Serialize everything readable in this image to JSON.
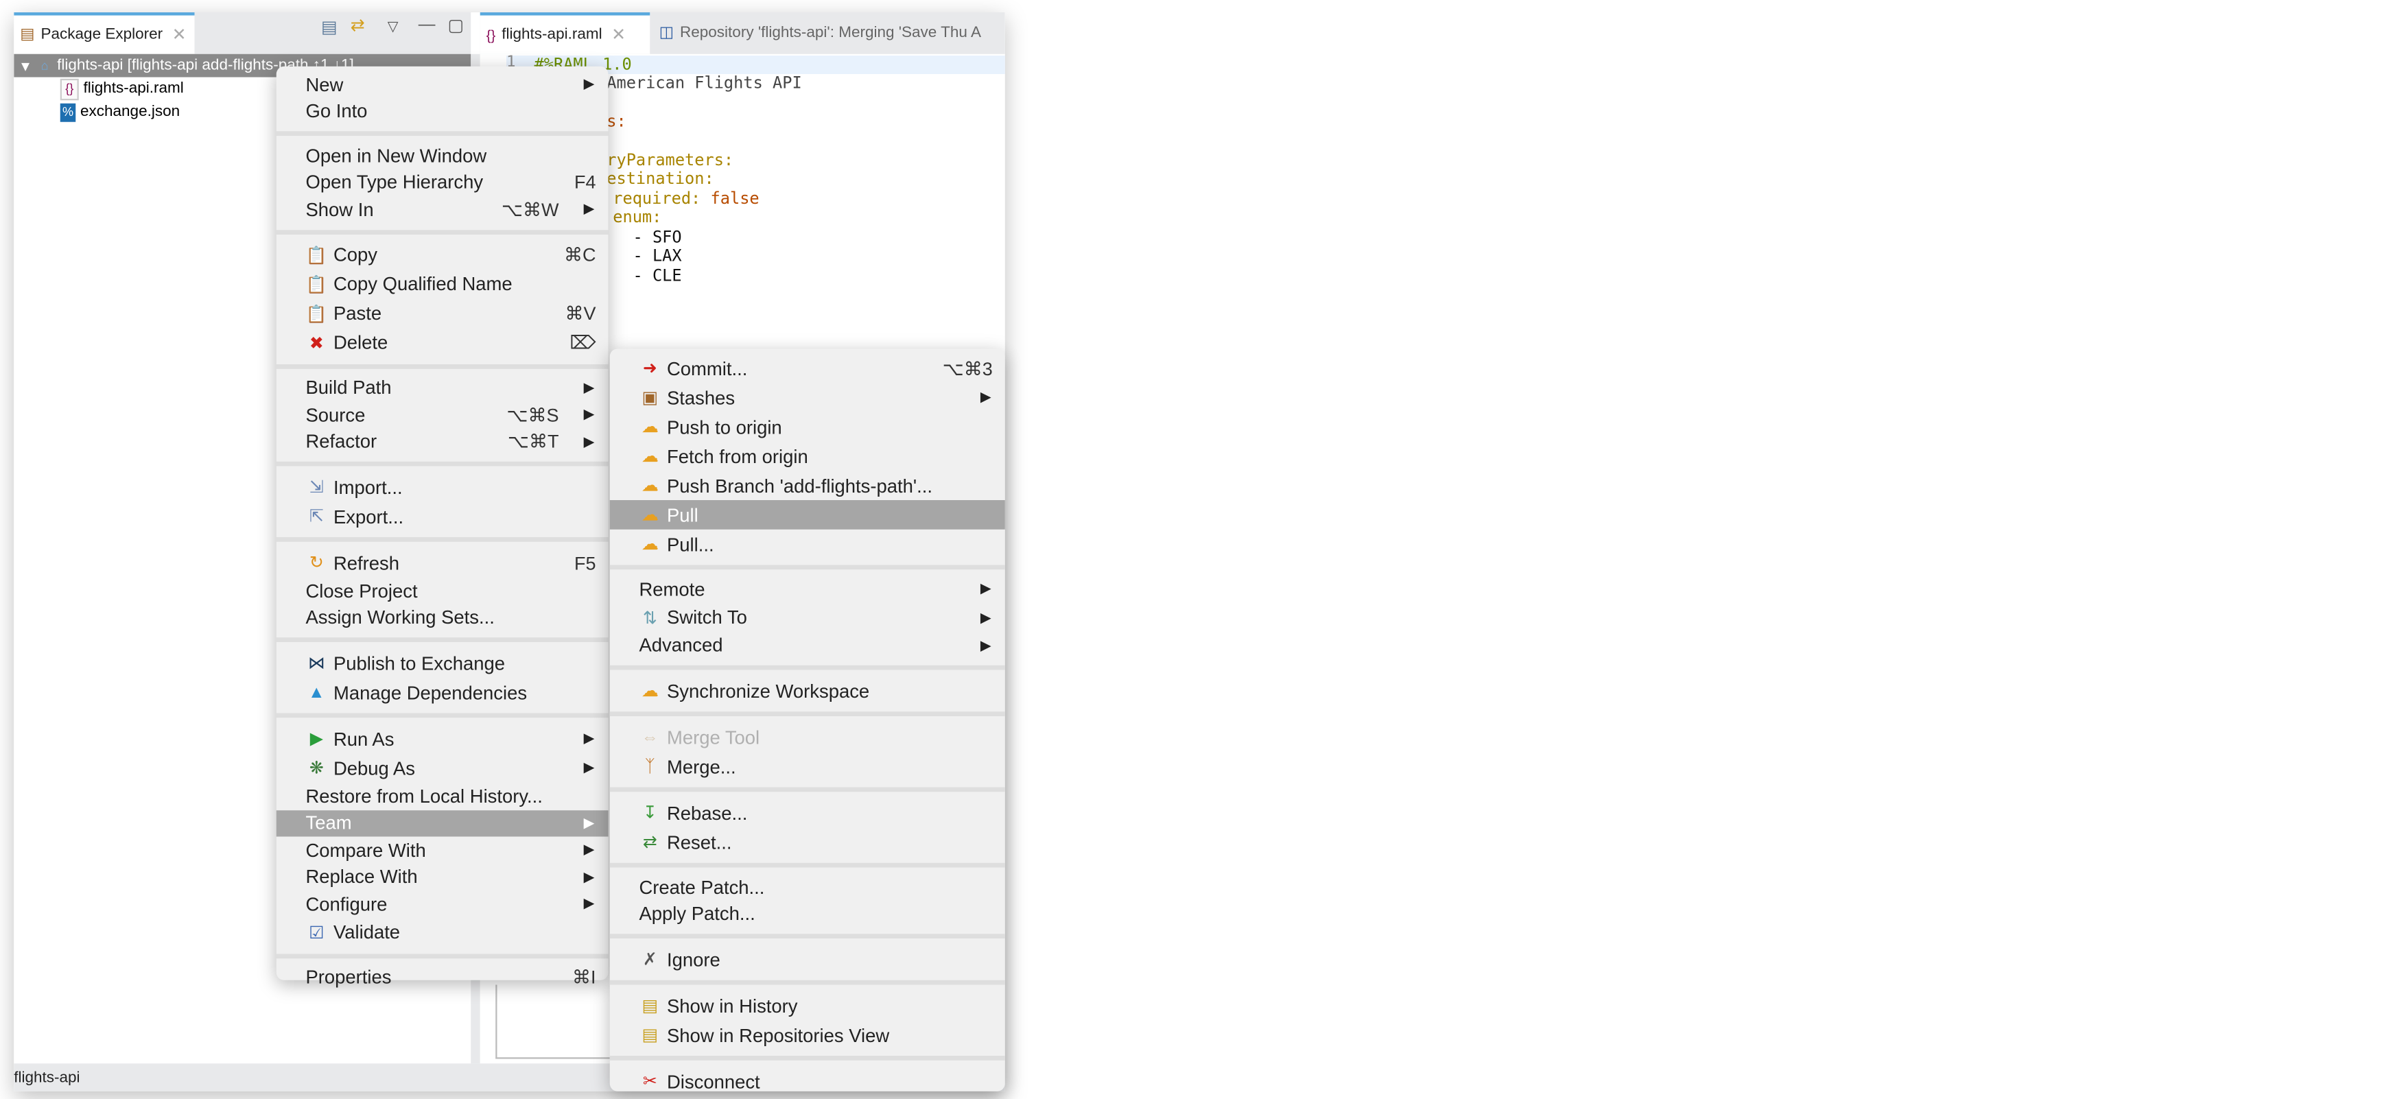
{
  "package_explorer": {
    "tab_label": "Package Explorer",
    "tree": [
      {
        "label": "flights-api [flights-api add-flights-path ↑1 ↓1]",
        "icon": "project-icon",
        "selected": true
      },
      {
        "label": "flights-api.raml",
        "icon": "raml-file-icon"
      },
      {
        "label": "exchange.json",
        "icon": "json-file-icon"
      }
    ]
  },
  "editor": {
    "tabs": [
      {
        "label": "flights-api.raml",
        "active": true
      },
      {
        "label": "Repository 'flights-api': Merging 'Save Thu A",
        "active": false
      }
    ],
    "line_number": "1",
    "visible_code": {
      "l1": "#%RAML 1.0",
      "l2": "American Flights API",
      "l4": "s:",
      "l6": "ryParameters:",
      "l7": "estination:",
      "l8_key": "required:",
      "l8_val": "false",
      "l9": "enum:",
      "l10": "- SFO",
      "l11": "- LAX",
      "l12": "- CLE"
    }
  },
  "status_bar": {
    "text": "flights-api"
  },
  "context_menu": [
    {
      "label": "New",
      "submenu": true
    },
    {
      "label": "Go Into"
    },
    {
      "separator": true
    },
    {
      "label": "Open in New Window"
    },
    {
      "label": "Open Type Hierarchy",
      "shortcut": "F4"
    },
    {
      "label": "Show In",
      "shortcut": "⌥⌘W",
      "submenu": true
    },
    {
      "separator": true
    },
    {
      "label": "Copy",
      "shortcut": "⌘C",
      "icon": "copy"
    },
    {
      "label": "Copy Qualified Name",
      "icon": "copy-qualified"
    },
    {
      "label": "Paste",
      "shortcut": "⌘V",
      "icon": "paste"
    },
    {
      "label": "Delete",
      "shortcut": "⌦",
      "icon": "delete"
    },
    {
      "separator": true
    },
    {
      "label": "Build Path",
      "submenu": true
    },
    {
      "label": "Source",
      "shortcut": "⌥⌘S",
      "submenu": true
    },
    {
      "label": "Refactor",
      "shortcut": "⌥⌘T",
      "submenu": true
    },
    {
      "separator": true
    },
    {
      "label": "Import...",
      "icon": "import"
    },
    {
      "label": "Export...",
      "icon": "export"
    },
    {
      "separator": true
    },
    {
      "label": "Refresh",
      "shortcut": "F5",
      "icon": "refresh"
    },
    {
      "label": "Close Project"
    },
    {
      "label": "Assign Working Sets..."
    },
    {
      "separator": true
    },
    {
      "label": "Publish to Exchange",
      "icon": "exchange"
    },
    {
      "label": "Manage Dependencies",
      "icon": "dependencies"
    },
    {
      "separator": true
    },
    {
      "label": "Run As",
      "submenu": true,
      "icon": "run"
    },
    {
      "label": "Debug As",
      "submenu": true,
      "icon": "debug"
    },
    {
      "label": "Restore from Local History..."
    },
    {
      "label": "Team",
      "submenu": true,
      "highlighted": true
    },
    {
      "label": "Compare With",
      "submenu": true
    },
    {
      "label": "Replace With",
      "submenu": true
    },
    {
      "label": "Configure",
      "submenu": true
    },
    {
      "label": "Validate",
      "icon": "checkbox-checked"
    },
    {
      "separator": true
    },
    {
      "label": "Properties",
      "shortcut": "⌘I"
    }
  ],
  "team_menu": [
    {
      "label": "Commit...",
      "shortcut": "⌥⌘3",
      "icon": "commit"
    },
    {
      "label": "Stashes",
      "submenu": true,
      "icon": "stash"
    },
    {
      "label": "Push to origin",
      "icon": "push"
    },
    {
      "label": "Fetch from origin",
      "icon": "fetch"
    },
    {
      "label": "Push Branch 'add-flights-path'...",
      "icon": "push"
    },
    {
      "label": "Pull",
      "icon": "pull",
      "highlighted": true
    },
    {
      "label": "Pull...",
      "icon": "pull-dialog"
    },
    {
      "separator": true
    },
    {
      "label": "Remote",
      "submenu": true
    },
    {
      "label": "Switch To",
      "submenu": true,
      "icon": "switch"
    },
    {
      "label": "Advanced",
      "submenu": true
    },
    {
      "separator": true
    },
    {
      "label": "Synchronize Workspace",
      "icon": "synchronize"
    },
    {
      "separator": true
    },
    {
      "label": "Merge Tool",
      "icon": "merge-tool",
      "disabled": true
    },
    {
      "label": "Merge...",
      "icon": "merge"
    },
    {
      "separator": true
    },
    {
      "label": "Rebase...",
      "icon": "rebase"
    },
    {
      "label": "Reset...",
      "icon": "reset"
    },
    {
      "separator": true
    },
    {
      "label": "Create Patch..."
    },
    {
      "label": "Apply Patch..."
    },
    {
      "separator": true
    },
    {
      "label": "Ignore",
      "icon": "ignore"
    },
    {
      "separator": true
    },
    {
      "label": "Show in History",
      "icon": "history"
    },
    {
      "label": "Show in Repositories View",
      "icon": "repositories"
    },
    {
      "separator": true
    },
    {
      "label": "Disconnect",
      "icon": "disconnect"
    }
  ],
  "colors": {
    "highlight": "#a6a6a6",
    "menu_bg": "#f0f0f0",
    "active_tab_accent": "#5aa9de",
    "selection": "#8a8a8a"
  }
}
